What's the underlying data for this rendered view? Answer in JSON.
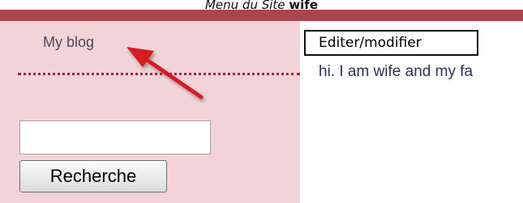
{
  "caption": {
    "lead": "Menu du Site",
    "strong": "wife"
  },
  "sidebar": {
    "link_label": "My blog",
    "search_placeholder": "",
    "search_button_label": "Recherche"
  },
  "content": {
    "edit_label": "Editer/modifier",
    "text": "hi. I am wife and my fa"
  },
  "colors": {
    "topbar": "#a8454d",
    "sidebar_bg": "#f2d4d8",
    "annotation_arrow": "#d41f24"
  }
}
